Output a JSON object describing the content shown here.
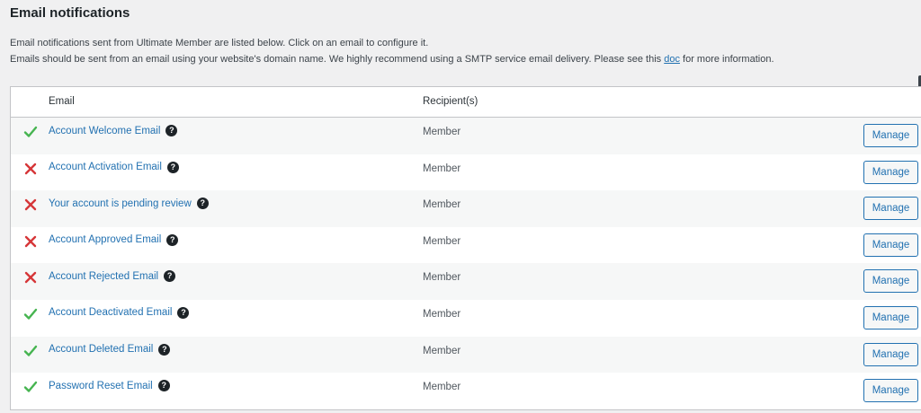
{
  "page": {
    "title": "Email notifications",
    "intro_line1": "Email notifications sent from Ultimate Member are listed below. Click on an email to configure it.",
    "intro_line2_before": "Emails should be sent from an email using your website's domain name. We highly recommend using a SMTP service email delivery. Please see this ",
    "intro_link": "doc",
    "intro_line2_after": " for more information."
  },
  "table": {
    "headers": {
      "email": "Email",
      "recipients": "Recipient(s)"
    },
    "rows": [
      {
        "status": "enabled",
        "status_icon": "check-icon",
        "email": "Account Welcome Email",
        "recipient": "Member",
        "action": "Manage"
      },
      {
        "status": "disabled",
        "status_icon": "cross-icon",
        "email": "Account Activation Email",
        "recipient": "Member",
        "action": "Manage"
      },
      {
        "status": "disabled",
        "status_icon": "cross-icon",
        "email": "Your account is pending review",
        "recipient": "Member",
        "action": "Manage"
      },
      {
        "status": "disabled",
        "status_icon": "cross-icon",
        "email": "Account Approved Email",
        "recipient": "Member",
        "action": "Manage"
      },
      {
        "status": "disabled",
        "status_icon": "cross-icon",
        "email": "Account Rejected Email",
        "recipient": "Member",
        "action": "Manage"
      },
      {
        "status": "enabled",
        "status_icon": "check-icon",
        "email": "Account Deactivated Email",
        "recipient": "Member",
        "action": "Manage"
      },
      {
        "status": "enabled",
        "status_icon": "check-icon",
        "email": "Account Deleted Email",
        "recipient": "Member",
        "action": "Manage"
      },
      {
        "status": "enabled",
        "status_icon": "check-icon",
        "email": "Password Reset Email",
        "recipient": "Member",
        "action": "Manage"
      }
    ]
  },
  "icons": {
    "help": "question-circle-icon",
    "help_glyph": "?"
  },
  "colors": {
    "enabled": "#46b450",
    "disabled": "#d63638",
    "link": "#2271b1"
  }
}
